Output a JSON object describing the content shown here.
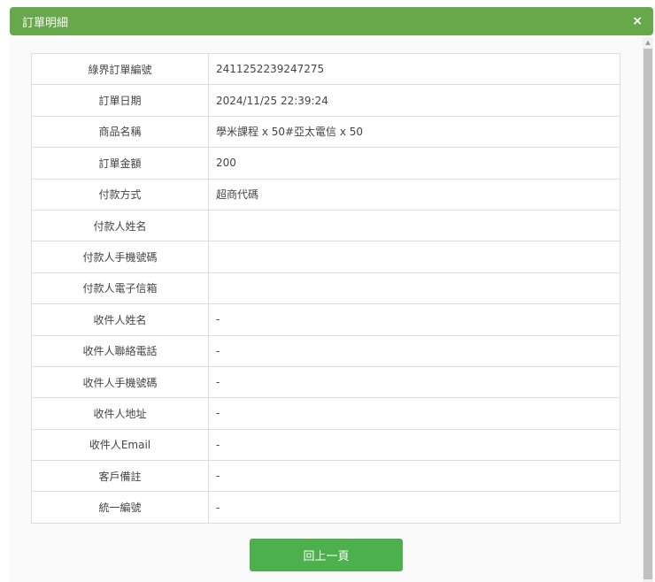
{
  "dialog": {
    "title": "訂單明細",
    "close_label": "×"
  },
  "rows": [
    {
      "label": "綠界訂單編號",
      "value": "2411252239247275"
    },
    {
      "label": "訂單日期",
      "value": "2024/11/25 22:39:24"
    },
    {
      "label": "商品名稱",
      "value": "學米課程 x 50#亞太電信 x 50"
    },
    {
      "label": "訂單金額",
      "value": "200"
    },
    {
      "label": "付款方式",
      "value": "超商代碼"
    },
    {
      "label": "付款人姓名",
      "value": ""
    },
    {
      "label": "付款人手機號碼",
      "value": ""
    },
    {
      "label": "付款人電子信箱",
      "value": ""
    },
    {
      "label": "收件人姓名",
      "value": "-"
    },
    {
      "label": "收件人聯絡電話",
      "value": "-"
    },
    {
      "label": "收件人手機號碼",
      "value": "-"
    },
    {
      "label": "收件人地址",
      "value": "-"
    },
    {
      "label": "收件人Email",
      "value": "-"
    },
    {
      "label": "客戶備註",
      "value": "-"
    },
    {
      "label": "統一編號",
      "value": "-"
    }
  ],
  "back_button": "回上一頁",
  "scroll_up_glyph": "▲"
}
